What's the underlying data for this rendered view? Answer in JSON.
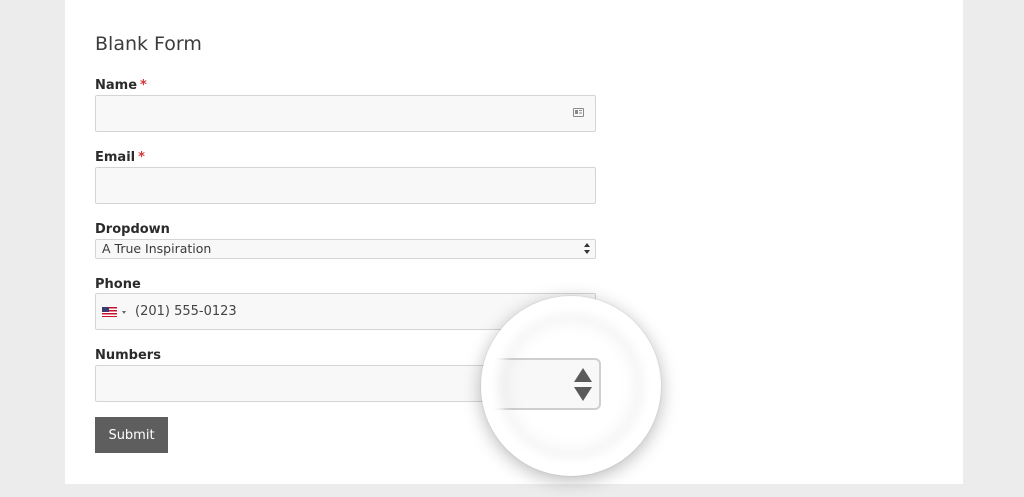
{
  "form": {
    "title": "Blank Form",
    "required_marker": "*",
    "fields": {
      "name": {
        "label": "Name",
        "value": "",
        "required": true,
        "icon": "contact-card-icon"
      },
      "email": {
        "label": "Email",
        "value": "",
        "required": true
      },
      "dropdown": {
        "label": "Dropdown",
        "selected": "A True Inspiration",
        "icon": "select-arrows-icon"
      },
      "phone": {
        "label": "Phone",
        "value": "(201) 555-0123",
        "country_icon": "us-flag-icon"
      },
      "numbers": {
        "label": "Numbers",
        "value": "",
        "icon": "number-spinner-icon"
      }
    },
    "submit_label": "Submit"
  },
  "colors": {
    "background": "#ececec",
    "card": "#ffffff",
    "required": "#d63638",
    "submit_bg": "#5e5e5e",
    "field_bg": "#f8f8f8",
    "field_border": "#d4d4d4"
  }
}
